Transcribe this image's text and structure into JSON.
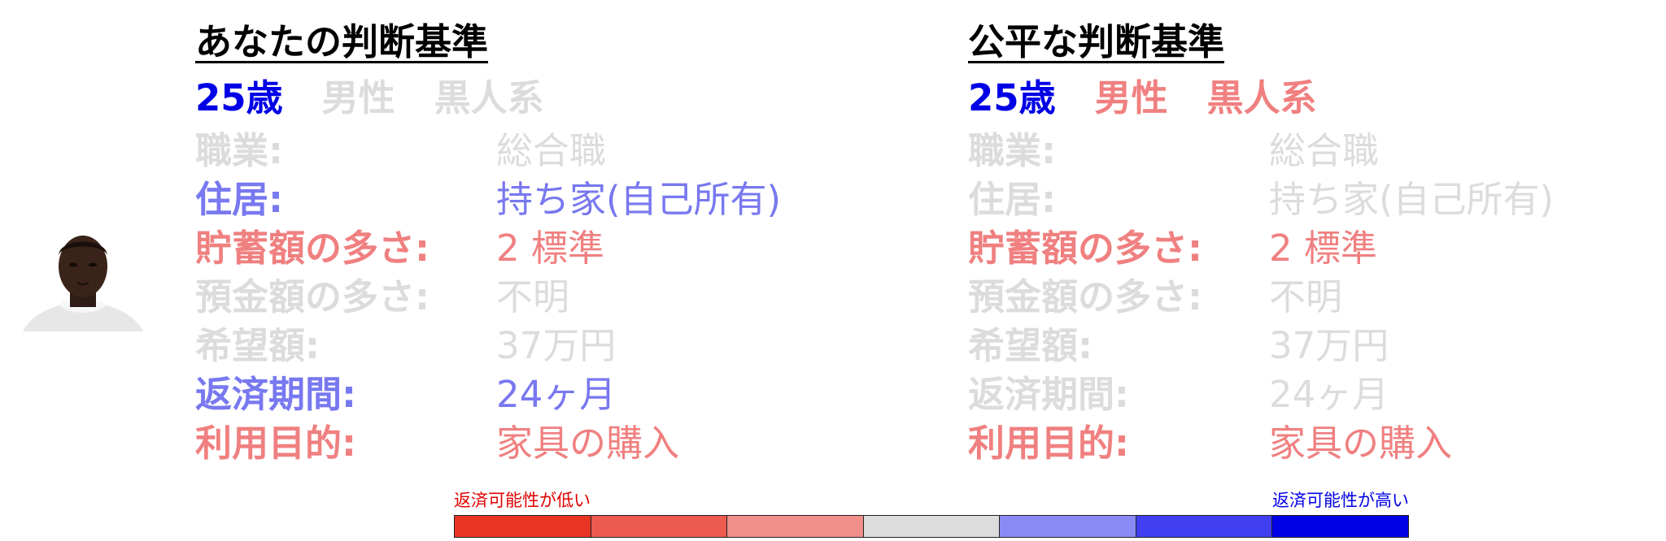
{
  "panels": [
    {
      "title": "あなたの判断基準",
      "demographics": [
        {
          "text": "25歳",
          "color": "blue"
        },
        {
          "text": "男性",
          "color": "grey"
        },
        {
          "text": "黒人系",
          "color": "grey"
        }
      ],
      "rows": [
        {
          "label": "職業:",
          "value": "総合職",
          "color": "grey"
        },
        {
          "label": "住居:",
          "value": "持ち家(自己所有)",
          "color": "lblue"
        },
        {
          "label": "貯蓄額の多さ:",
          "value": "2 標準",
          "color": "red"
        },
        {
          "label": "預金額の多さ:",
          "value": "不明",
          "color": "grey"
        },
        {
          "label": "希望額:",
          "value": "37万円",
          "color": "grey"
        },
        {
          "label": "返済期間:",
          "value": "24ヶ月",
          "color": "lblue"
        },
        {
          "label": "利用目的:",
          "value": "家具の購入",
          "color": "red"
        }
      ]
    },
    {
      "title": "公平な判断基準",
      "demographics": [
        {
          "text": "25歳",
          "color": "blue"
        },
        {
          "text": "男性",
          "color": "red"
        },
        {
          "text": "黒人系",
          "color": "red"
        }
      ],
      "rows": [
        {
          "label": "職業:",
          "value": "総合職",
          "color": "grey"
        },
        {
          "label": "住居:",
          "value": "持ち家(自己所有)",
          "color": "grey"
        },
        {
          "label": "貯蓄額の多さ:",
          "value": "2 標準",
          "color": "red"
        },
        {
          "label": "預金額の多さ:",
          "value": "不明",
          "color": "grey"
        },
        {
          "label": "希望額:",
          "value": "37万円",
          "color": "grey"
        },
        {
          "label": "返済期間:",
          "value": "24ヶ月",
          "color": "grey"
        },
        {
          "label": "利用目的:",
          "value": "家具の購入",
          "color": "red"
        }
      ]
    }
  ],
  "legend": {
    "low_label": "返済可能性が低い",
    "high_label": "返済可能性が高い",
    "colors": [
      "#e83524",
      "#ec5a50",
      "#f08f8b",
      "#dcdcdc",
      "#8a8af5",
      "#4040f2",
      "#0000e6"
    ]
  },
  "avatar": {
    "icon": "person-portrait-icon"
  }
}
